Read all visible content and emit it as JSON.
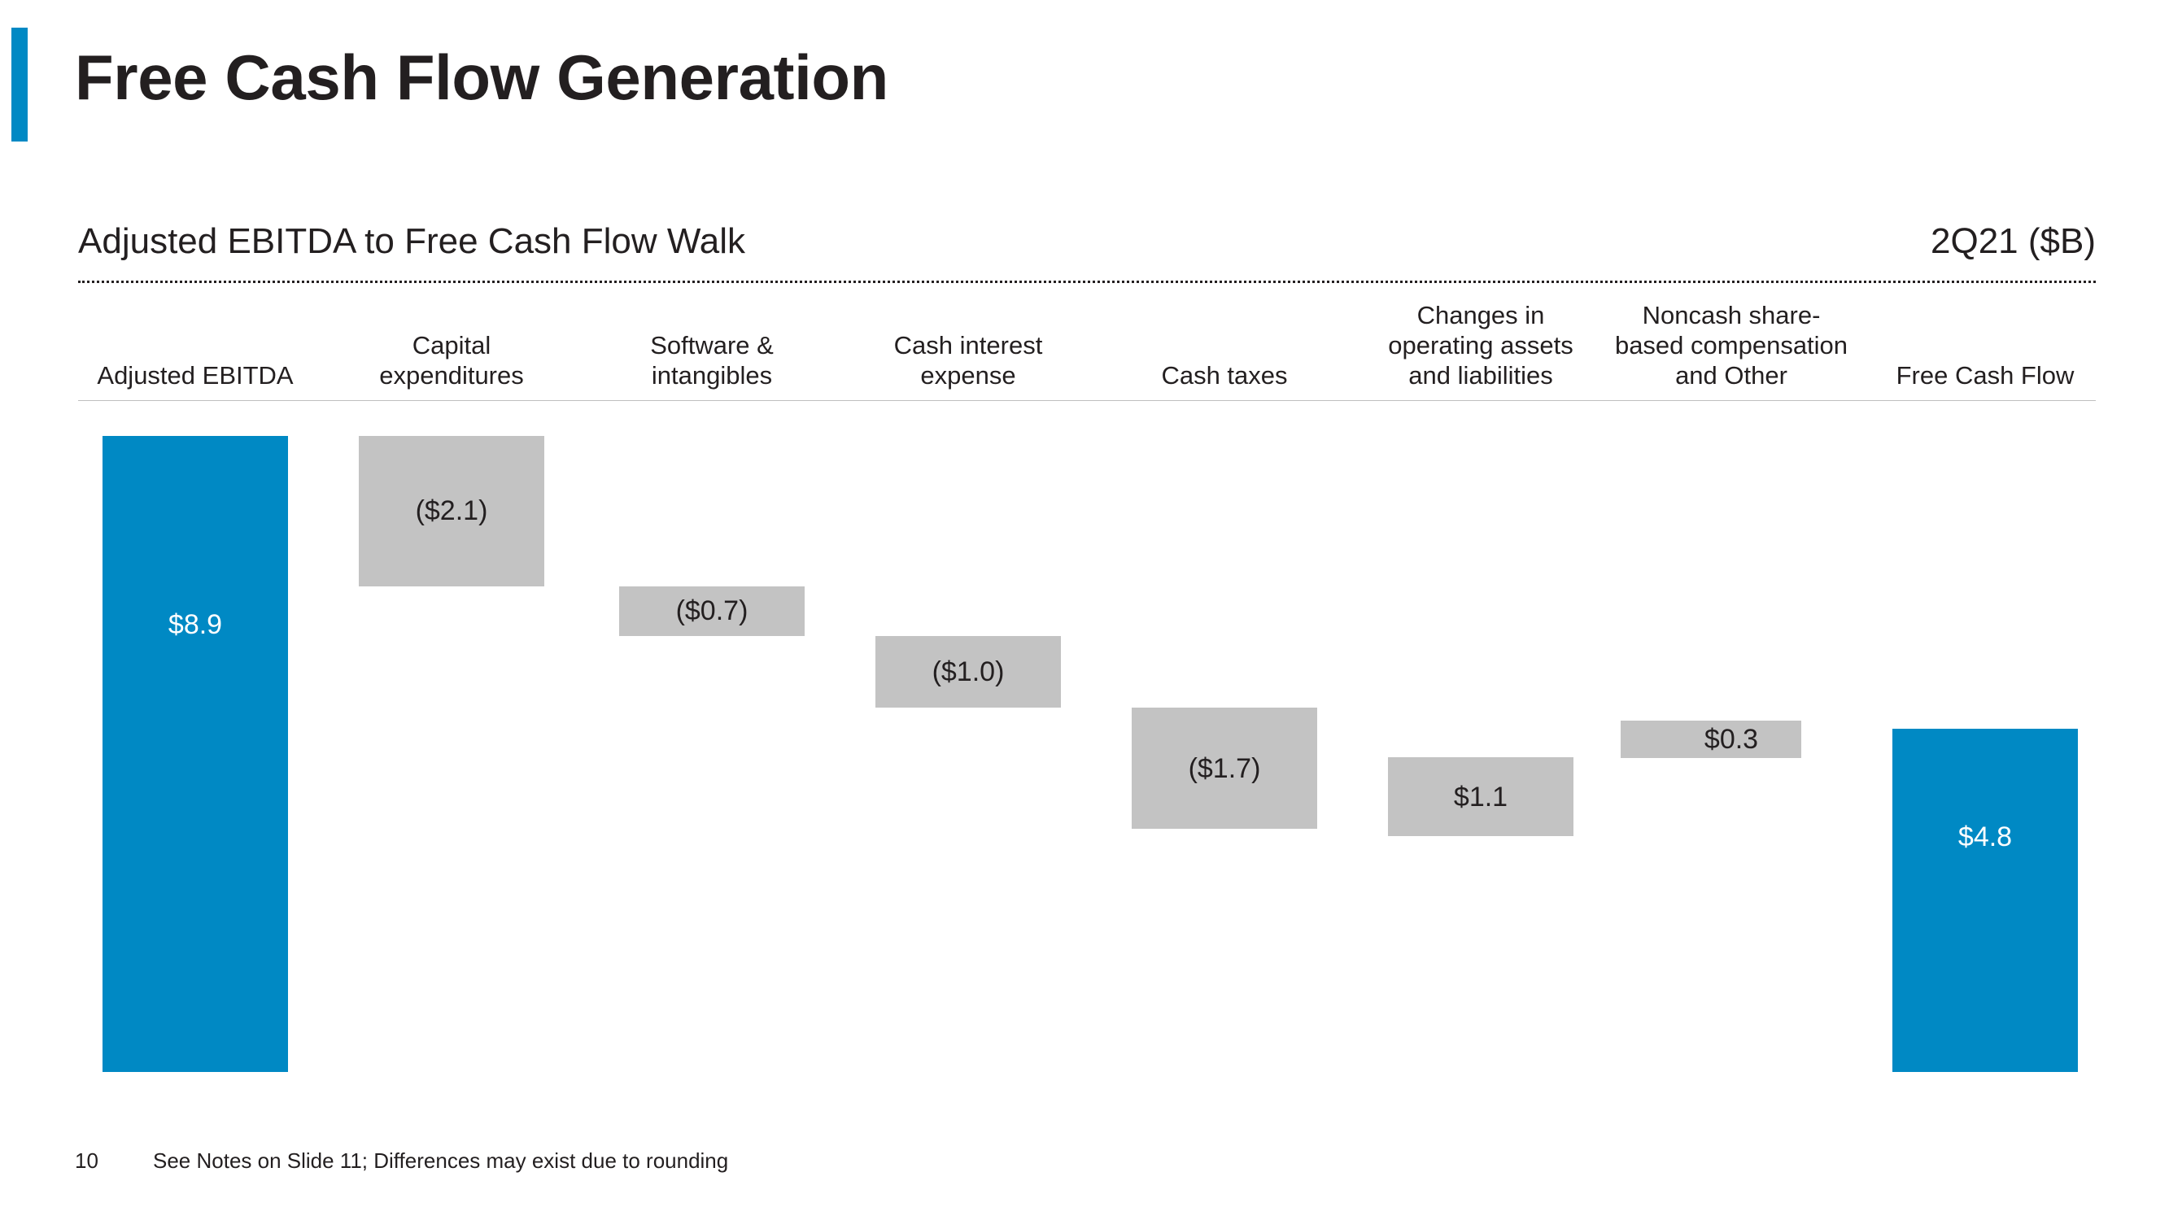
{
  "slide": {
    "title": "Free Cash Flow Generation",
    "section_title": "Adjusted EBITDA to Free Cash Flow Walk",
    "period_label": "2Q21 ($B)",
    "slide_number": "10",
    "footnote": "See Notes on Slide 11; Differences may exist due to rounding",
    "accent_color": "#0089c4",
    "bar_positive_color": "#0089c4",
    "bar_negative_color": "#c3c3c3"
  },
  "chart_data": {
    "type": "bar",
    "subtype": "waterfall",
    "title": "Adjusted EBITDA to Free Cash Flow Walk",
    "units": "2Q21 ($B)",
    "xlabel": "",
    "ylabel": "",
    "grid": false,
    "legend": "none",
    "ylim": [
      0,
      8.9
    ],
    "categories": [
      "Adjusted EBITDA",
      "Capital expenditures",
      "Software & intangibles",
      "Cash interest expense",
      "Cash taxes",
      "Changes in operating assets and liabilities",
      "Noncash share-based compensation and Other",
      "Free Cash Flow"
    ],
    "values": [
      8.9,
      -2.1,
      -0.7,
      -1.0,
      -1.7,
      1.1,
      0.3,
      4.8
    ],
    "labels": [
      "$8.9",
      "($2.1)",
      "($0.7)",
      "($1.0)",
      "($1.7)",
      "$1.1",
      "$0.3",
      "$4.8"
    ],
    "bars": [
      {
        "category": "Adjusted EBITDA",
        "header_lines": [
          "Adjusted EBITDA"
        ],
        "value": 8.9,
        "label": "$8.9",
        "kind": "total",
        "color": "#0089c4",
        "label_color": "#ffffff",
        "start": 0.0,
        "end": 8.9
      },
      {
        "category": "Capital expenditures",
        "header_lines": [
          "Capital",
          "expenditures"
        ],
        "value": -2.1,
        "label": "($2.1)",
        "kind": "decrease",
        "color": "#c3c3c3",
        "label_color": "#231f20",
        "start": 8.9,
        "end": 6.8
      },
      {
        "category": "Software & intangibles",
        "header_lines": [
          "Software &",
          "intangibles"
        ],
        "value": -0.7,
        "label": "($0.7)",
        "kind": "decrease",
        "color": "#c3c3c3",
        "label_color": "#231f20",
        "start": 6.8,
        "end": 6.1
      },
      {
        "category": "Cash interest expense",
        "header_lines": [
          "Cash interest",
          "expense"
        ],
        "value": -1.0,
        "label": "($1.0)",
        "kind": "decrease",
        "color": "#c3c3c3",
        "label_color": "#231f20",
        "start": 6.1,
        "end": 5.1
      },
      {
        "category": "Cash taxes",
        "header_lines": [
          "Cash taxes"
        ],
        "value": -1.7,
        "label": "($1.7)",
        "kind": "decrease",
        "color": "#c3c3c3",
        "label_color": "#231f20",
        "start": 5.1,
        "end": 3.4
      },
      {
        "category": "Changes in operating assets and liabilities",
        "header_lines": [
          "Changes in",
          "operating assets",
          "and liabilities"
        ],
        "value": 1.1,
        "label": "$1.1",
        "kind": "increase",
        "color": "#c3c3c3",
        "label_color": "#231f20",
        "start": 3.3,
        "end": 4.4
      },
      {
        "category": "Noncash share-based compensation and Other",
        "header_lines": [
          "Noncash share-",
          "based compensation",
          "and Other"
        ],
        "value": 0.3,
        "label": "$0.3",
        "kind": "increase",
        "color": "#c3c3c3",
        "label_color": "#231f20",
        "start": 4.5,
        "end": 4.8
      },
      {
        "category": "Free Cash Flow",
        "header_lines": [
          "Free Cash Flow"
        ],
        "value": 4.8,
        "label": "$4.8",
        "kind": "total",
        "color": "#0089c4",
        "label_color": "#ffffff",
        "start": 0.0,
        "end": 4.8
      }
    ]
  }
}
